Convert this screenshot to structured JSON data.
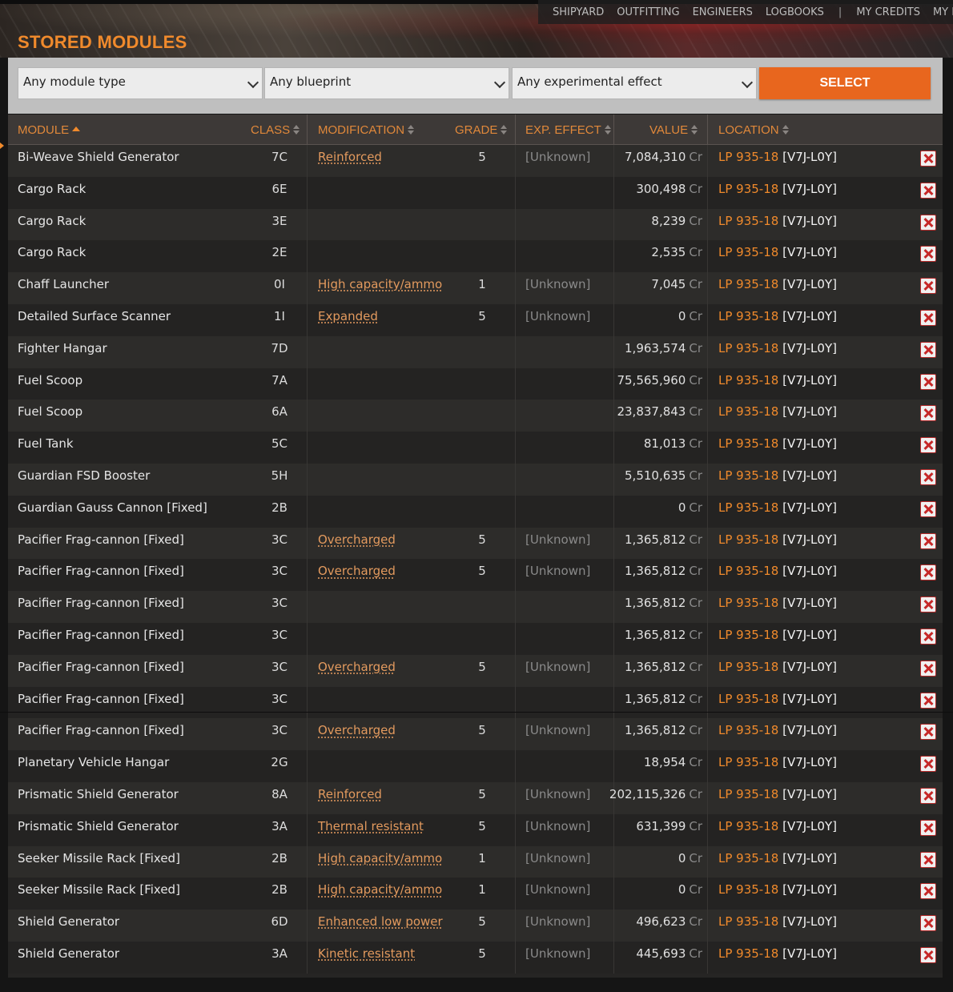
{
  "nav": {
    "items": [
      "SHIPYARD",
      "OUTFITTING",
      "ENGINEERS",
      "LOGBOOKS",
      "|",
      "MY CREDITS",
      "MY RA"
    ]
  },
  "page_title": "STORED MODULES",
  "filters": {
    "module_type": "Any module type",
    "blueprint": "Any blueprint",
    "experimental": "Any experimental effect",
    "select_label": "SELECT"
  },
  "columns": {
    "module": "MODULE",
    "class": "CLASS",
    "modification": "MODIFICATION",
    "grade": "GRADE",
    "exp_effect": "EXP. EFFECT",
    "value": "VALUE",
    "location": "LOCATION"
  },
  "currency": "Cr",
  "rows": [
    {
      "module": "Bi-Weave Shield Generator",
      "class": "7C",
      "modification": "Reinforced",
      "grade": "5",
      "exp": "[Unknown]",
      "value": "7,084,310",
      "system": "LP 935-18",
      "station": "[V7J-L0Y]"
    },
    {
      "module": "Cargo Rack",
      "class": "6E",
      "modification": "",
      "grade": "",
      "exp": "",
      "value": "300,498",
      "system": "LP 935-18",
      "station": "[V7J-L0Y]"
    },
    {
      "module": "Cargo Rack",
      "class": "3E",
      "modification": "",
      "grade": "",
      "exp": "",
      "value": "8,239",
      "system": "LP 935-18",
      "station": "[V7J-L0Y]"
    },
    {
      "module": "Cargo Rack",
      "class": "2E",
      "modification": "",
      "grade": "",
      "exp": "",
      "value": "2,535",
      "system": "LP 935-18",
      "station": "[V7J-L0Y]"
    },
    {
      "module": "Chaff Launcher",
      "class": "0I",
      "modification": "High capacity/ammo",
      "grade": "1",
      "exp": "[Unknown]",
      "value": "7,045",
      "system": "LP 935-18",
      "station": "[V7J-L0Y]"
    },
    {
      "module": "Detailed Surface Scanner",
      "class": "1I",
      "modification": "Expanded",
      "grade": "5",
      "exp": "[Unknown]",
      "value": "0",
      "system": "LP 935-18",
      "station": "[V7J-L0Y]"
    },
    {
      "module": "Fighter Hangar",
      "class": "7D",
      "modification": "",
      "grade": "",
      "exp": "",
      "value": "1,963,574",
      "system": "LP 935-18",
      "station": "[V7J-L0Y]"
    },
    {
      "module": "Fuel Scoop",
      "class": "7A",
      "modification": "",
      "grade": "",
      "exp": "",
      "value": "75,565,960",
      "system": "LP 935-18",
      "station": "[V7J-L0Y]"
    },
    {
      "module": "Fuel Scoop",
      "class": "6A",
      "modification": "",
      "grade": "",
      "exp": "",
      "value": "23,837,843",
      "system": "LP 935-18",
      "station": "[V7J-L0Y]"
    },
    {
      "module": "Fuel Tank",
      "class": "5C",
      "modification": "",
      "grade": "",
      "exp": "",
      "value": "81,013",
      "system": "LP 935-18",
      "station": "[V7J-L0Y]"
    },
    {
      "module": "Guardian FSD Booster",
      "class": "5H",
      "modification": "",
      "grade": "",
      "exp": "",
      "value": "5,510,635",
      "system": "LP 935-18",
      "station": "[V7J-L0Y]"
    },
    {
      "module": "Guardian Gauss Cannon [Fixed]",
      "class": "2B",
      "modification": "",
      "grade": "",
      "exp": "",
      "value": "0",
      "system": "LP 935-18",
      "station": "[V7J-L0Y]"
    },
    {
      "module": "Pacifier Frag-cannon [Fixed]",
      "class": "3C",
      "modification": "Overcharged",
      "grade": "5",
      "exp": "[Unknown]",
      "value": "1,365,812",
      "system": "LP 935-18",
      "station": "[V7J-L0Y]"
    },
    {
      "module": "Pacifier Frag-cannon [Fixed]",
      "class": "3C",
      "modification": "Overcharged",
      "grade": "5",
      "exp": "[Unknown]",
      "value": "1,365,812",
      "system": "LP 935-18",
      "station": "[V7J-L0Y]"
    },
    {
      "module": "Pacifier Frag-cannon [Fixed]",
      "class": "3C",
      "modification": "",
      "grade": "",
      "exp": "",
      "value": "1,365,812",
      "system": "LP 935-18",
      "station": "[V7J-L0Y]"
    },
    {
      "module": "Pacifier Frag-cannon [Fixed]",
      "class": "3C",
      "modification": "",
      "grade": "",
      "exp": "",
      "value": "1,365,812",
      "system": "LP 935-18",
      "station": "[V7J-L0Y]"
    },
    {
      "module": "Pacifier Frag-cannon [Fixed]",
      "class": "3C",
      "modification": "Overcharged",
      "grade": "5",
      "exp": "[Unknown]",
      "value": "1,365,812",
      "system": "LP 935-18",
      "station": "[V7J-L0Y]"
    },
    {
      "module": "Pacifier Frag-cannon [Fixed]",
      "class": "3C",
      "modification": "",
      "grade": "",
      "exp": "",
      "value": "1,365,812",
      "system": "LP 935-18",
      "station": "[V7J-L0Y]"
    },
    {
      "module": "Pacifier Frag-cannon [Fixed]",
      "class": "3C",
      "modification": "Overcharged",
      "grade": "5",
      "exp": "[Unknown]",
      "value": "1,365,812",
      "system": "LP 935-18",
      "station": "[V7J-L0Y]"
    },
    {
      "module": "Planetary Vehicle Hangar",
      "class": "2G",
      "modification": "",
      "grade": "",
      "exp": "",
      "value": "18,954",
      "system": "LP 935-18",
      "station": "[V7J-L0Y]"
    },
    {
      "module": "Prismatic Shield Generator",
      "class": "8A",
      "modification": "Reinforced",
      "grade": "5",
      "exp": "[Unknown]",
      "value": "202,115,326",
      "system": "LP 935-18",
      "station": "[V7J-L0Y]"
    },
    {
      "module": "Prismatic Shield Generator",
      "class": "3A",
      "modification": "Thermal resistant",
      "grade": "5",
      "exp": "[Unknown]",
      "value": "631,399",
      "system": "LP 935-18",
      "station": "[V7J-L0Y]"
    },
    {
      "module": "Seeker Missile Rack [Fixed]",
      "class": "2B",
      "modification": "High capacity/ammo",
      "grade": "1",
      "exp": "[Unknown]",
      "value": "0",
      "system": "LP 935-18",
      "station": "[V7J-L0Y]"
    },
    {
      "module": "Seeker Missile Rack [Fixed]",
      "class": "2B",
      "modification": "High capacity/ammo",
      "grade": "1",
      "exp": "[Unknown]",
      "value": "0",
      "system": "LP 935-18",
      "station": "[V7J-L0Y]"
    },
    {
      "module": "Shield Generator",
      "class": "6D",
      "modification": "Enhanced low power",
      "grade": "5",
      "exp": "[Unknown]",
      "value": "496,623",
      "system": "LP 935-18",
      "station": "[V7J-L0Y]"
    },
    {
      "module": "Shield Generator",
      "class": "3A",
      "modification": "Kinetic resistant",
      "grade": "5",
      "exp": "[Unknown]",
      "value": "445,693",
      "system": "LP 935-18",
      "station": "[V7J-L0Y]"
    }
  ],
  "colors": {
    "accent": "#f08a2c",
    "button": "#e8661e",
    "delete": "#c62828"
  }
}
